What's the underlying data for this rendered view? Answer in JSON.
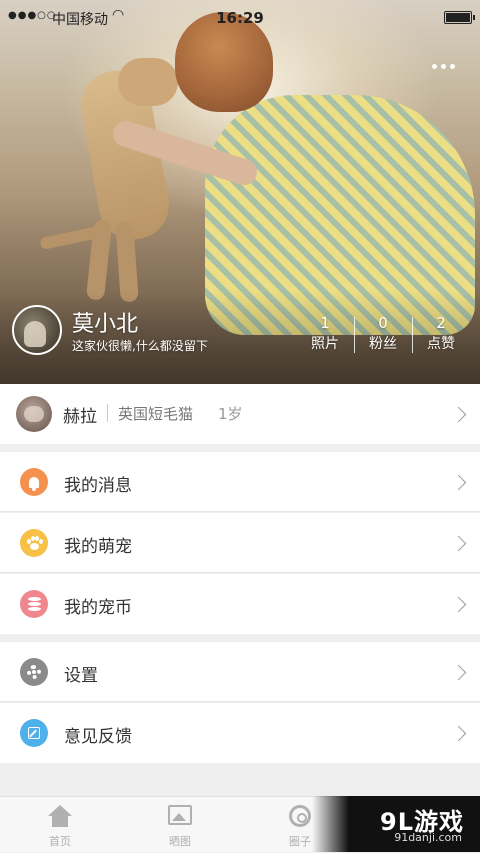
{
  "status_bar": {
    "signal": "●●●○○",
    "carrier": "中国移动",
    "wifi_icon": "wifi-icon",
    "time": "16:29",
    "battery_icon": "battery-icon"
  },
  "header": {
    "more_icon": "more-dots-icon",
    "user_name": "莫小北",
    "bio": "这家伙很懒,什么都没留下",
    "stats": [
      {
        "value": "1",
        "label": "照片"
      },
      {
        "value": "0",
        "label": "粉丝"
      },
      {
        "value": "2",
        "label": "点赞"
      }
    ]
  },
  "pet": {
    "name": "赫拉",
    "breed": "英国短毛猫",
    "age": "1岁"
  },
  "menu_group_1": [
    {
      "label": "我的消息",
      "icon": "bell-icon",
      "color": "#f5914e"
    },
    {
      "label": "我的萌宠",
      "icon": "paw-icon",
      "color": "#f7c046"
    },
    {
      "label": "我的宠币",
      "icon": "coins-icon",
      "color": "#f0878f"
    }
  ],
  "menu_group_2": [
    {
      "label": "设置",
      "icon": "gear-icon",
      "color": "#8a8a8a"
    },
    {
      "label": "意见反馈",
      "icon": "edit-icon",
      "color": "#4fb0ea"
    }
  ],
  "tabbar": {
    "tabs": [
      {
        "label": "首页",
        "icon": "home-icon"
      },
      {
        "label": "晒图",
        "icon": "photo-icon"
      },
      {
        "label": "圈子",
        "icon": "circle-icon"
      }
    ]
  },
  "watermark": {
    "logo": "9L游戏",
    "site": "91danji.com"
  }
}
